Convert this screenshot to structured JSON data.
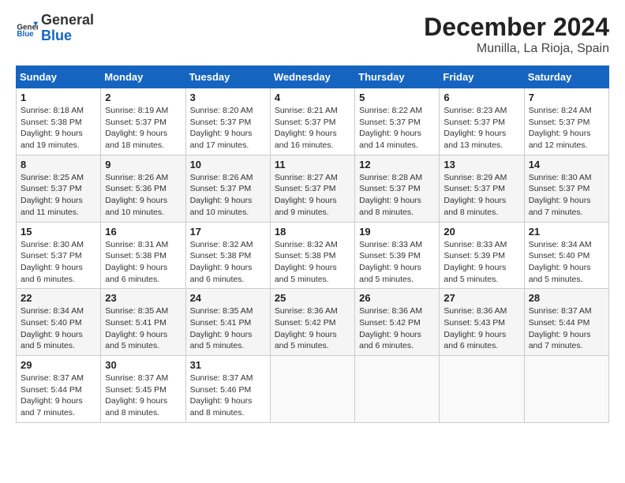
{
  "logo": {
    "general": "General",
    "blue": "Blue"
  },
  "title": {
    "month_year": "December 2024",
    "location": "Munilla, La Rioja, Spain"
  },
  "calendar": {
    "headers": [
      "Sunday",
      "Monday",
      "Tuesday",
      "Wednesday",
      "Thursday",
      "Friday",
      "Saturday"
    ],
    "weeks": [
      [
        {
          "day": "1",
          "sunrise": "8:18 AM",
          "sunset": "5:38 PM",
          "daylight": "9 hours and 19 minutes."
        },
        {
          "day": "2",
          "sunrise": "8:19 AM",
          "sunset": "5:37 PM",
          "daylight": "9 hours and 18 minutes."
        },
        {
          "day": "3",
          "sunrise": "8:20 AM",
          "sunset": "5:37 PM",
          "daylight": "9 hours and 17 minutes."
        },
        {
          "day": "4",
          "sunrise": "8:21 AM",
          "sunset": "5:37 PM",
          "daylight": "9 hours and 16 minutes."
        },
        {
          "day": "5",
          "sunrise": "8:22 AM",
          "sunset": "5:37 PM",
          "daylight": "9 hours and 14 minutes."
        },
        {
          "day": "6",
          "sunrise": "8:23 AM",
          "sunset": "5:37 PM",
          "daylight": "9 hours and 13 minutes."
        },
        {
          "day": "7",
          "sunrise": "8:24 AM",
          "sunset": "5:37 PM",
          "daylight": "9 hours and 12 minutes."
        }
      ],
      [
        {
          "day": "8",
          "sunrise": "8:25 AM",
          "sunset": "5:37 PM",
          "daylight": "9 hours and 11 minutes."
        },
        {
          "day": "9",
          "sunrise": "8:26 AM",
          "sunset": "5:36 PM",
          "daylight": "9 hours and 10 minutes."
        },
        {
          "day": "10",
          "sunrise": "8:26 AM",
          "sunset": "5:37 PM",
          "daylight": "9 hours and 10 minutes."
        },
        {
          "day": "11",
          "sunrise": "8:27 AM",
          "sunset": "5:37 PM",
          "daylight": "9 hours and 9 minutes."
        },
        {
          "day": "12",
          "sunrise": "8:28 AM",
          "sunset": "5:37 PM",
          "daylight": "9 hours and 8 minutes."
        },
        {
          "day": "13",
          "sunrise": "8:29 AM",
          "sunset": "5:37 PM",
          "daylight": "9 hours and 8 minutes."
        },
        {
          "day": "14",
          "sunrise": "8:30 AM",
          "sunset": "5:37 PM",
          "daylight": "9 hours and 7 minutes."
        }
      ],
      [
        {
          "day": "15",
          "sunrise": "8:30 AM",
          "sunset": "5:37 PM",
          "daylight": "9 hours and 6 minutes."
        },
        {
          "day": "16",
          "sunrise": "8:31 AM",
          "sunset": "5:38 PM",
          "daylight": "9 hours and 6 minutes."
        },
        {
          "day": "17",
          "sunrise": "8:32 AM",
          "sunset": "5:38 PM",
          "daylight": "9 hours and 6 minutes."
        },
        {
          "day": "18",
          "sunrise": "8:32 AM",
          "sunset": "5:38 PM",
          "daylight": "9 hours and 5 minutes."
        },
        {
          "day": "19",
          "sunrise": "8:33 AM",
          "sunset": "5:39 PM",
          "daylight": "9 hours and 5 minutes."
        },
        {
          "day": "20",
          "sunrise": "8:33 AM",
          "sunset": "5:39 PM",
          "daylight": "9 hours and 5 minutes."
        },
        {
          "day": "21",
          "sunrise": "8:34 AM",
          "sunset": "5:40 PM",
          "daylight": "9 hours and 5 minutes."
        }
      ],
      [
        {
          "day": "22",
          "sunrise": "8:34 AM",
          "sunset": "5:40 PM",
          "daylight": "9 hours and 5 minutes."
        },
        {
          "day": "23",
          "sunrise": "8:35 AM",
          "sunset": "5:41 PM",
          "daylight": "9 hours and 5 minutes."
        },
        {
          "day": "24",
          "sunrise": "8:35 AM",
          "sunset": "5:41 PM",
          "daylight": "9 hours and 5 minutes."
        },
        {
          "day": "25",
          "sunrise": "8:36 AM",
          "sunset": "5:42 PM",
          "daylight": "9 hours and 5 minutes."
        },
        {
          "day": "26",
          "sunrise": "8:36 AM",
          "sunset": "5:42 PM",
          "daylight": "9 hours and 6 minutes."
        },
        {
          "day": "27",
          "sunrise": "8:36 AM",
          "sunset": "5:43 PM",
          "daylight": "9 hours and 6 minutes."
        },
        {
          "day": "28",
          "sunrise": "8:37 AM",
          "sunset": "5:44 PM",
          "daylight": "9 hours and 7 minutes."
        }
      ],
      [
        {
          "day": "29",
          "sunrise": "8:37 AM",
          "sunset": "5:44 PM",
          "daylight": "9 hours and 7 minutes."
        },
        {
          "day": "30",
          "sunrise": "8:37 AM",
          "sunset": "5:45 PM",
          "daylight": "9 hours and 8 minutes."
        },
        {
          "day": "31",
          "sunrise": "8:37 AM",
          "sunset": "5:46 PM",
          "daylight": "9 hours and 8 minutes."
        },
        null,
        null,
        null,
        null
      ]
    ]
  }
}
